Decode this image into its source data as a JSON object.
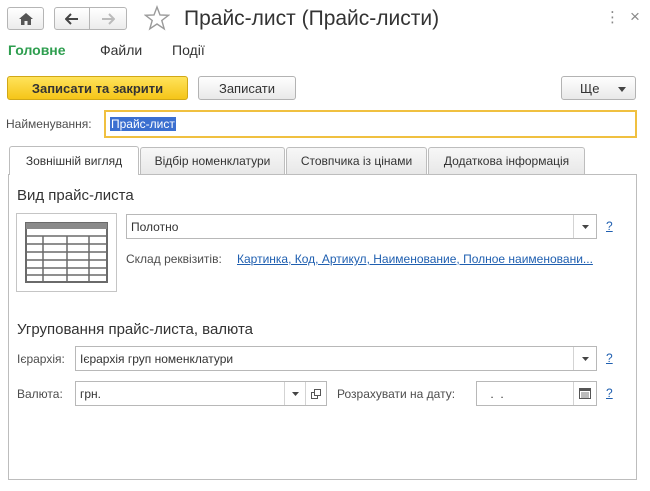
{
  "window": {
    "title": "Прайс-лист (Прайс-листи)",
    "close_glyph": "×",
    "more_glyph": "⋮"
  },
  "menu": {
    "items": [
      {
        "label": "Головне",
        "active": true
      },
      {
        "label": "Файли",
        "active": false
      },
      {
        "label": "Події",
        "active": false
      }
    ]
  },
  "toolbar": {
    "save_close_label": "Записати та закрити",
    "save_label": "Записати",
    "more_label": "Ще"
  },
  "name_field": {
    "label": "Найменування:",
    "value": "Прайс-лист"
  },
  "tabs": [
    {
      "label": "Зовнішній вигляд",
      "active": true
    },
    {
      "label": "Відбір номенклатури",
      "active": false
    },
    {
      "label": "Стовпчика із цінами",
      "active": false
    },
    {
      "label": "Додаткова інформація",
      "active": false
    }
  ],
  "view_section": {
    "title": "Вид прайс-листа",
    "view_value": "Полотно",
    "help": "?",
    "composition_label": "Склад реквізитів:",
    "composition_link": "Картинка, Код, Артикул, Наименование, Полное наименовани..."
  },
  "grouping_section": {
    "title": "Угруповання прайс-листа, валюта",
    "hierarchy_label": "Ієрархія:",
    "hierarchy_value": "Ієрархія груп номенклатури",
    "currency_label": "Валюта:",
    "currency_value": "грн.",
    "date_label": "Розрахувати на дату:",
    "date_value": " .  .",
    "help": "?"
  },
  "colors": {
    "accent_green": "#2e9e4f",
    "primary_button": "#f5c518",
    "link_blue": "#1f5fb0",
    "focus_border": "#f0c040",
    "selection": "#3b6fd0"
  }
}
